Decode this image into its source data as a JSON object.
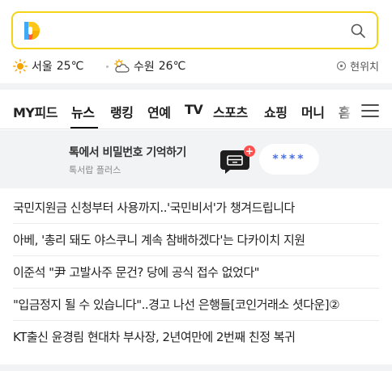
{
  "search": {
    "placeholder": ""
  },
  "weather": [
    {
      "icon": "sun-icon",
      "city": "서울",
      "temp": "25℃"
    },
    {
      "icon": "cloud-sun-icon",
      "city": "수원",
      "temp": "26℃"
    }
  ],
  "location": {
    "label": "현위치"
  },
  "tabs": [
    "MY피드",
    "뉴스",
    "랭킹",
    "연예",
    "TV",
    "스포츠",
    "쇼핑",
    "머니",
    "홈"
  ],
  "active_tab": "뉴스",
  "banner": {
    "title": "톡에서 비밀번호 기억하기",
    "subtitle": "톡서랍 플러스",
    "badge": "+",
    "pill": "****"
  },
  "news": [
    "국민지원금 신청부터 사용까지..'국민비서'가 챙겨드립니다",
    "아베, '총리 돼도 야스쿠니 계속 참배하겠다'는 다카이치 지원",
    "이준석 \"尹 고발사주 문건? 당에 공식 접수 없었다\"",
    "\"입금정지 될 수 있습니다\"..경고 나선 은행들[코인거래소 셧다운]②",
    "KT출신 윤경림 현대차 부사장, 2년여만에 2번째 친정 복귀"
  ],
  "colors": {
    "search_border": "#f5d417",
    "pill_text": "#4a6fe0",
    "badge": "#ff4f4f"
  }
}
